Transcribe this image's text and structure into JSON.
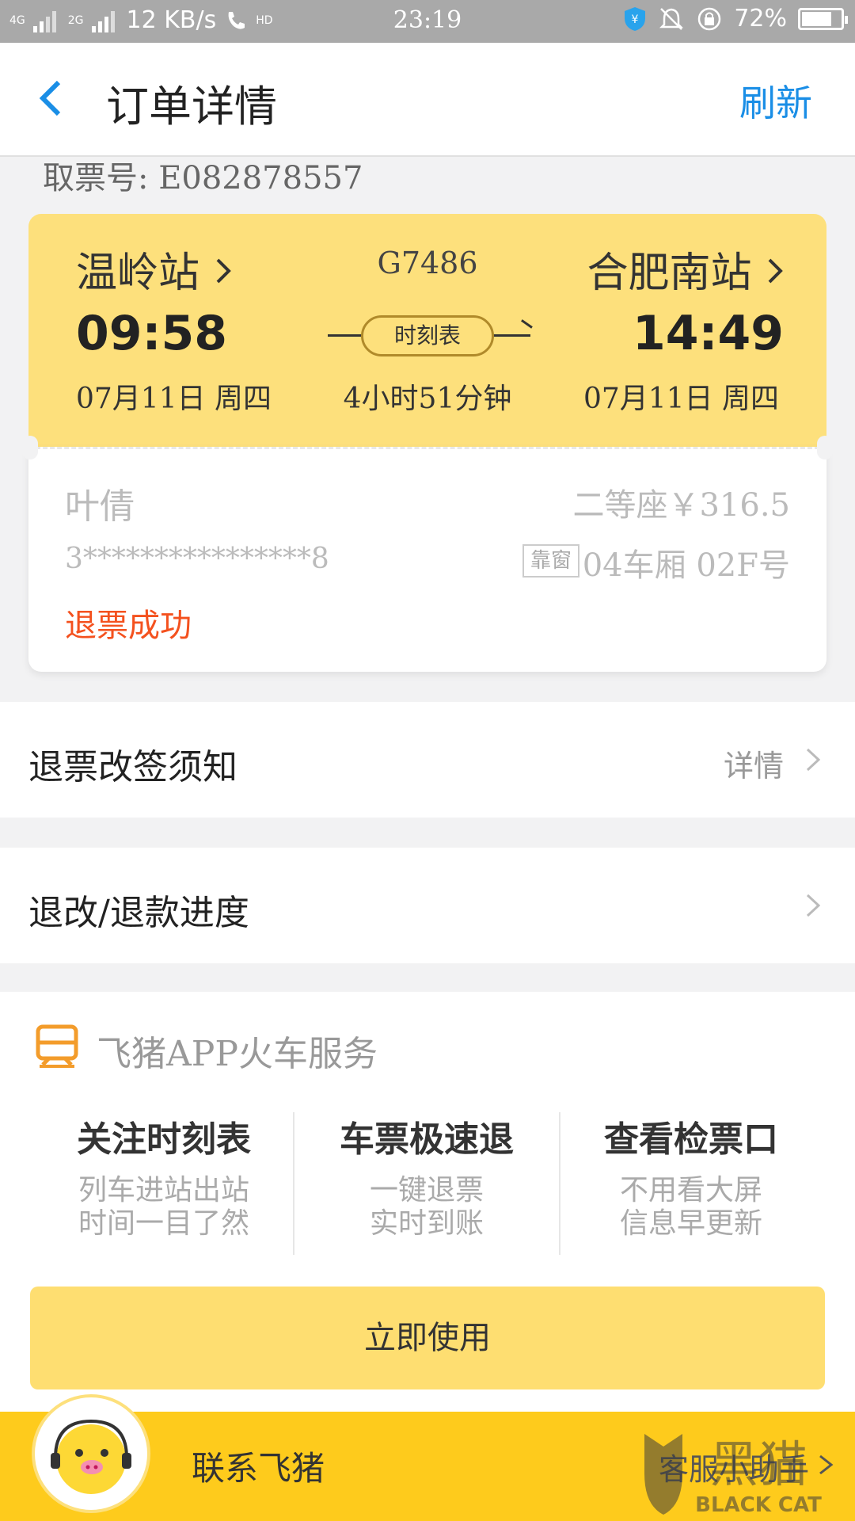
{
  "status_bar": {
    "signal_4g": "4G",
    "signal_2g": "2G",
    "net_speed": "12 KB/s",
    "hd_label": "HD",
    "time": "23:19",
    "battery": "72%"
  },
  "header": {
    "title": "订单详情",
    "refresh": "刷新"
  },
  "order": {
    "pickup_no": "取票号: E082878557"
  },
  "ticket": {
    "from_station": "温岭站",
    "to_station": "合肥南站",
    "train_no": "G7486",
    "depart_time": "09:58",
    "arrive_time": "14:49",
    "depart_date": "07月11日 周四",
    "arrive_date": "07月11日 周四",
    "schedule_btn": "时刻表",
    "duration": "4小时51分钟",
    "passenger": "叶倩",
    "seat_price": "二等座￥316.5",
    "id_masked": "3****************8",
    "window_tag": "靠窗",
    "seat_no": "04车厢 02F号",
    "status": "退票成功"
  },
  "rows": {
    "notice_label": "退票改签须知",
    "notice_detail": "详情",
    "progress_label": "退改/退款进度"
  },
  "service": {
    "title": "飞猪APP火车服务",
    "features": [
      {
        "title": "关注时刻表",
        "line1": "列车进站出站",
        "line2": "时间一目了然"
      },
      {
        "title": "车票极速退",
        "line1": "一键退票",
        "line2": "实时到账"
      },
      {
        "title": "查看检票口",
        "line1": "不用看大屏",
        "line2": "信息早更新"
      }
    ],
    "use_button": "立即使用"
  },
  "bottom": {
    "contact": "联系飞猪",
    "helper": "客服小助手"
  },
  "watermark": {
    "text_cn": "黑猫",
    "text_en": "BLACK CAT"
  },
  "colors": {
    "accent_blue": "#1a8ee6",
    "ticket_yellow": "#fde07c",
    "status_red": "#f4511e",
    "bar_yellow": "#fecb1c"
  }
}
